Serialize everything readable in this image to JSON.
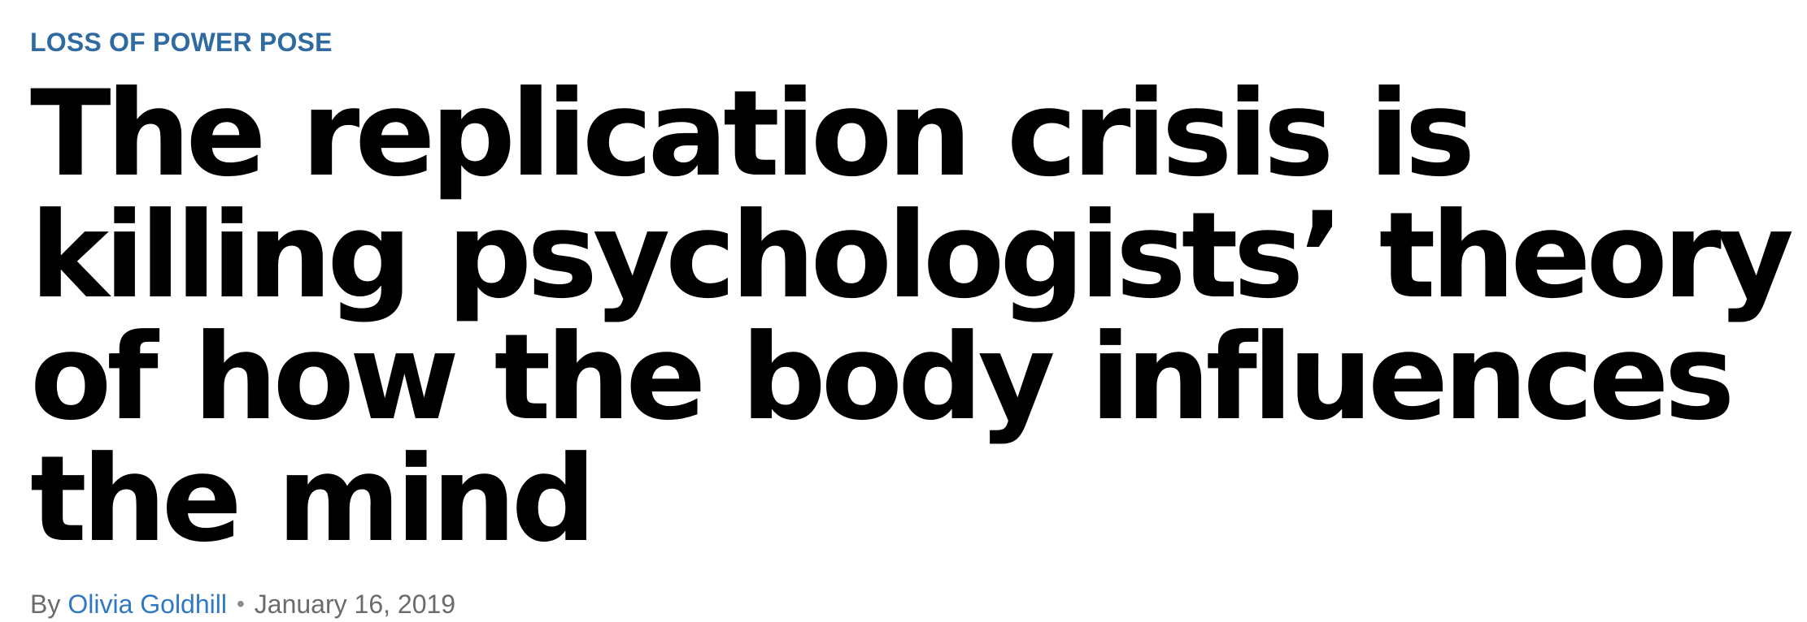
{
  "article": {
    "kicker": "LOSS OF POWER POSE",
    "headline": "The replication crisis is killing psychologists’ theory of how the body influences the mind",
    "byline": {
      "prefix": "By",
      "author": "Olivia Goldhill",
      "separator": "•",
      "date": "January 16, 2019"
    }
  },
  "colors": {
    "kicker": "#2f6aa0",
    "headline": "#000000",
    "author_link": "#2f78c4",
    "byline_text": "#6b6b6b",
    "background": "#ffffff"
  }
}
